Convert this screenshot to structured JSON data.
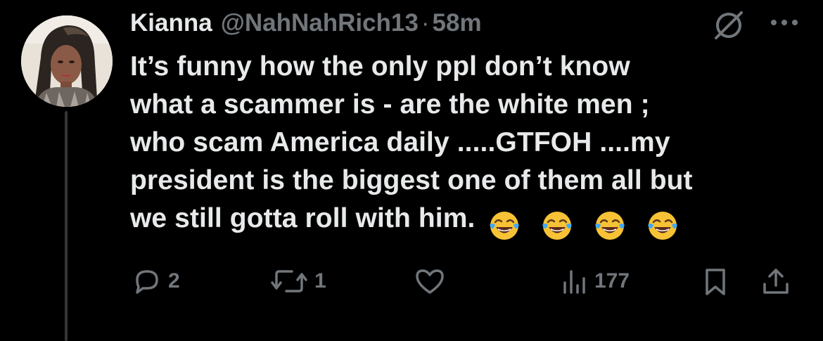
{
  "tweet": {
    "author": {
      "display_name": "Kianna",
      "handle": "@NahNahRich13",
      "separator": "·",
      "time": "58m"
    },
    "text_lines": [
      "It’s funny how the only ppl don’t know",
      "what a scammer is - are the white men ;",
      "who scam America daily .....GTFOH ....my",
      "president is the biggest one of them all but",
      "we still gotta roll with him."
    ],
    "emojis": [
      "face-with-tears-of-joy-icon",
      "face-with-tears-of-joy-icon",
      "face-with-tears-of-joy-icon",
      "face-with-tears-of-joy-icon"
    ],
    "actions": {
      "replies": "2",
      "reposts": "1",
      "likes": "",
      "views": "177"
    }
  },
  "colors": {
    "background": "#000000",
    "text_primary": "#e7e9ea",
    "text_secondary": "#71767b",
    "thread_line": "#333639"
  }
}
